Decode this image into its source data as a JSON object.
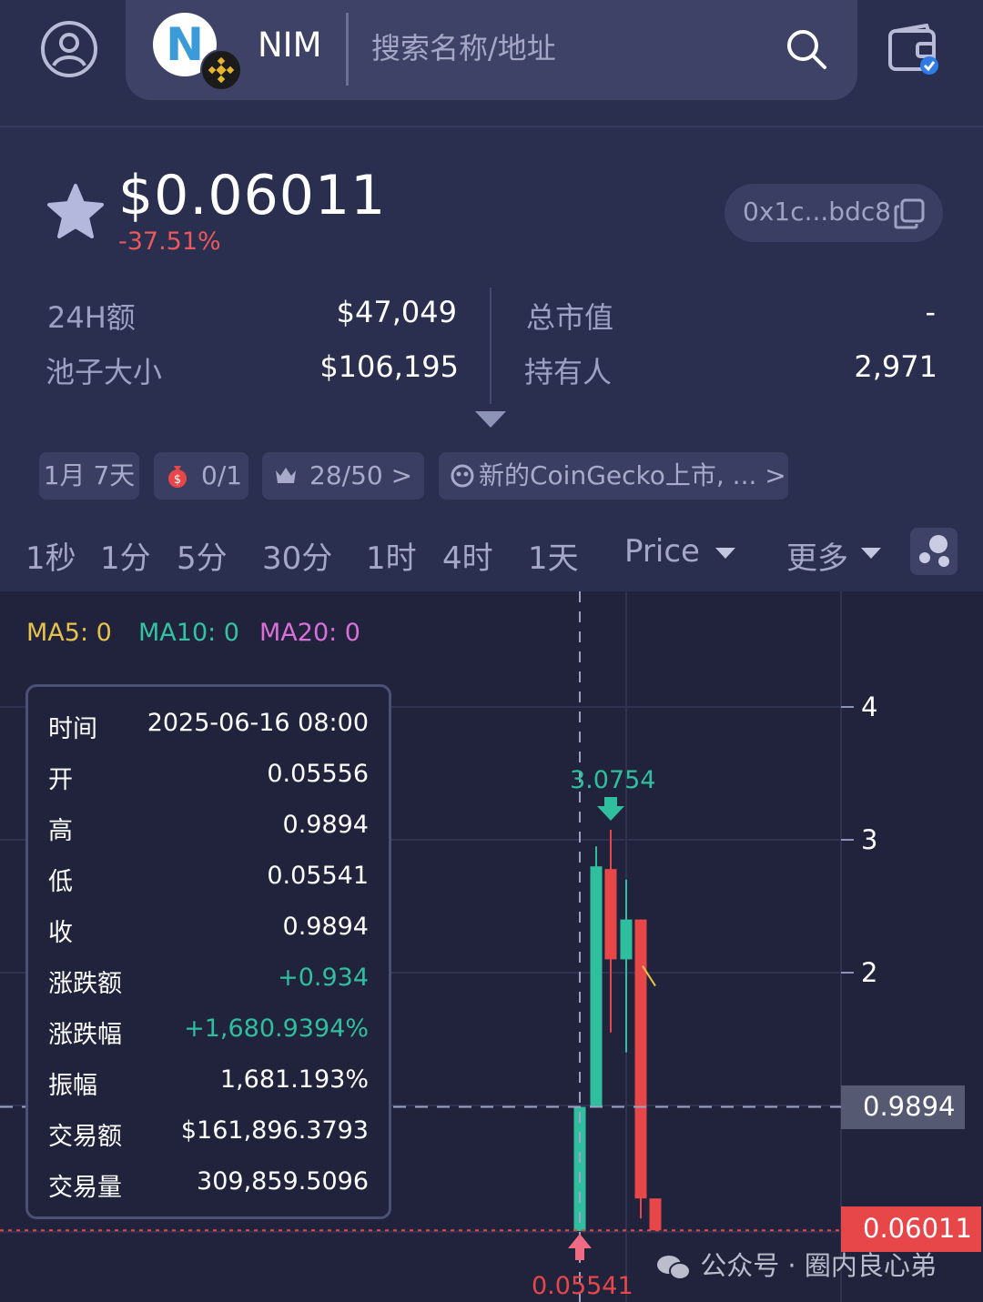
{
  "header": {
    "token_symbol": "NIM",
    "search_placeholder": "搜索名称/地址"
  },
  "price": {
    "value": "$0.06011",
    "change": "-37.51%",
    "address": "0x1c...bdc8"
  },
  "stats": {
    "volume_label": "24H额",
    "volume_value": "$47,049",
    "pool_label": "池子大小",
    "pool_value": "$106,195",
    "mcap_label": "总市值",
    "mcap_value": "-",
    "holders_label": "持有人",
    "holders_value": "2,971"
  },
  "tags": {
    "age": "1月 7天",
    "tax": "0/1",
    "rank": "28/50 >",
    "news": "新的CoinGecko上市, ... >"
  },
  "tabs": [
    "1秒",
    "1分",
    "5分",
    "30分",
    "1时",
    "4时",
    "1天"
  ],
  "dropdowns": {
    "price": "Price",
    "more": "更多"
  },
  "indicators": {
    "ma5": "MA5: 0",
    "ma10": "MA10: 0",
    "ma20": "MA20: 0"
  },
  "tooltip": {
    "rows": [
      {
        "label": "时间",
        "value": "2025-06-16 08:00"
      },
      {
        "label": "开",
        "value": "0.05556"
      },
      {
        "label": "高",
        "value": "0.9894"
      },
      {
        "label": "低",
        "value": "0.05541"
      },
      {
        "label": "收",
        "value": "0.9894"
      },
      {
        "label": "涨跌额",
        "value": "+0.934"
      },
      {
        "label": "涨跌幅",
        "value": "+1,680.9394%"
      },
      {
        "label": "振幅",
        "value": "1,681.193%"
      },
      {
        "label": "交易额",
        "value": "$161,896.3793"
      },
      {
        "label": "交易量",
        "value": "309,859.5096"
      }
    ]
  },
  "chart": {
    "y_ticks": [
      "4",
      "3",
      "2"
    ],
    "crosshair_price": "0.9894",
    "last_price": "0.06011",
    "high_marker": "3.0754",
    "low_marker": "0.05541"
  },
  "watermark": "公众号 · 圈内良心弟",
  "colors": {
    "up": "#2fbf9f",
    "down": "#e8474a",
    "background": "#2b2f4f",
    "chart_bg": "#21233c"
  },
  "chart_data": {
    "type": "candlestick",
    "ylim": [
      0,
      4.4
    ],
    "series": [
      {
        "open": 0.05556,
        "high": 0.9894,
        "low": 0.05541,
        "close": 0.9894
      },
      {
        "open": 0.99,
        "high": 2.95,
        "low": 0.99,
        "close": 2.8
      },
      {
        "open": 2.78,
        "high": 3.0754,
        "low": 1.55,
        "close": 2.1
      },
      {
        "open": 2.1,
        "high": 2.7,
        "low": 1.4,
        "close": 2.4
      },
      {
        "open": 2.4,
        "high": 2.4,
        "low": 0.15,
        "close": 0.3
      },
      {
        "open": 0.3,
        "high": 0.3,
        "low": 0.06011,
        "close": 0.06011
      }
    ]
  }
}
